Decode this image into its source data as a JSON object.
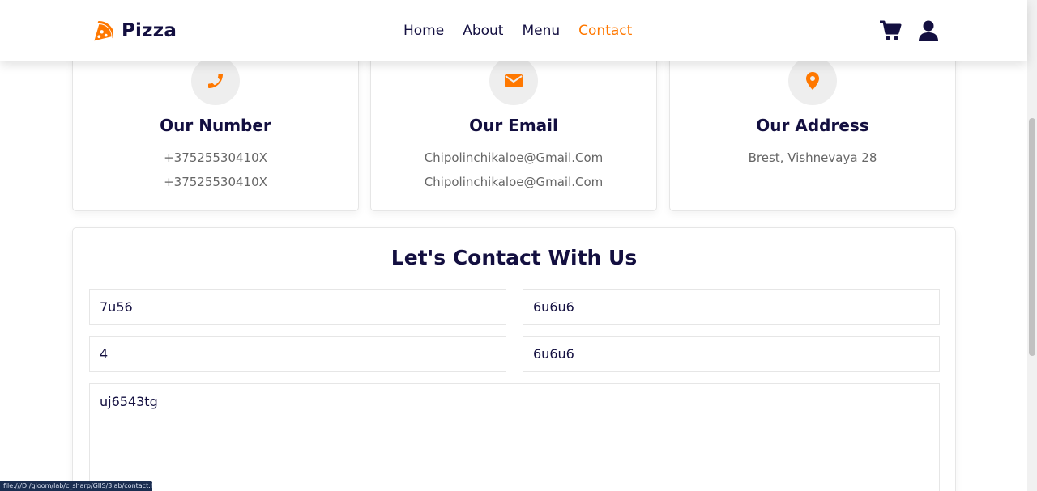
{
  "header": {
    "logo_text": "Pizza",
    "nav": [
      "Home",
      "About",
      "Menu",
      "Contact"
    ],
    "active_nav": "Contact"
  },
  "colors": {
    "accent": "#ff7800",
    "heading": "#130f40",
    "text": "#666666",
    "icon_bg": "#eeeeee"
  },
  "info": [
    {
      "icon": "phone-icon",
      "title": "Our Number",
      "lines": [
        "+37525530410X",
        "+37525530410X"
      ]
    },
    {
      "icon": "envelope-icon",
      "title": "Our Email",
      "lines": [
        "Chipolinchikaloe@Gmail.Com",
        "Chipolinchikaloe@Gmail.Com"
      ]
    },
    {
      "icon": "map-marker-icon",
      "title": "Our Address",
      "lines": [
        "Brest, Vishnevaya 28"
      ]
    }
  ],
  "form": {
    "title": "Let's Contact With Us",
    "field1": "7u56",
    "field2": "6u6u6",
    "field3": "4",
    "field4": "6u6u6",
    "message": "uj6543tg"
  },
  "status_url": "file:///D:/gloom/lab/c_sharp/GIIS/3lab/contact.html"
}
